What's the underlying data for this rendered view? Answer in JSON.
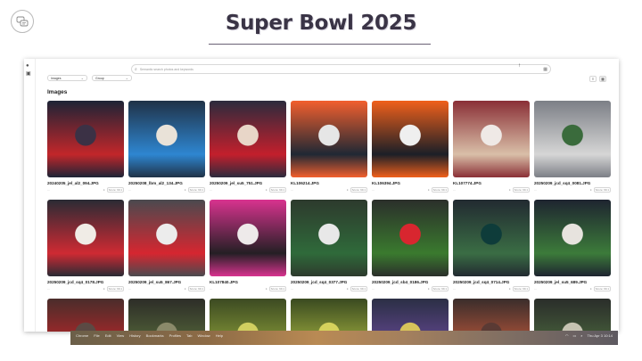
{
  "slide": {
    "title": "Super Bowl 2025"
  },
  "app": {
    "search_placeholder": "Semantic search photos and keywords",
    "filters": [
      "Images",
      "Group"
    ],
    "section_title": "Images",
    "photos": [
      {
        "name": "20240205_jel_al2_094.JPG",
        "meta": "...",
        "badge": "Score: 99.1",
        "colors": [
          "#1d2436",
          "#c2262a",
          "#3b3145"
        ]
      },
      {
        "name": "20250208_lbm_al2_134.JPG",
        "meta": "...",
        "badge": "Score: 99.1",
        "colors": [
          "#203247",
          "#2e86d1",
          "#e9e2d8"
        ]
      },
      {
        "name": "20250209_jel_su5_751.JPG",
        "meta": "...",
        "badge": "Score: 99.1",
        "colors": [
          "#2c2b3d",
          "#c31f2c",
          "#e8d6c8"
        ]
      },
      {
        "name": "KL106214.JPG",
        "meta": "...",
        "badge": "Score: 99.1",
        "colors": [
          "#f25f2e",
          "#1f2834",
          "#e6e6e6"
        ]
      },
      {
        "name": "KL106394.JPG",
        "meta": "...",
        "badge": "Score: 99.1",
        "colors": [
          "#f0601b",
          "#1b1f27",
          "#efefef"
        ]
      },
      {
        "name": "KL107774.JPG",
        "meta": "...",
        "badge": "Score: 99.1",
        "colors": [
          "#8a2f36",
          "#d9bfa8",
          "#efe9e6"
        ]
      },
      {
        "name": "20250209_jcd_sq4_0081.JPG",
        "meta": "...",
        "badge": "Score: 99.1",
        "colors": [
          "#7c7f86",
          "#d6d6d6",
          "#3a6b3c"
        ]
      },
      {
        "name": "20250209_jcd_sq4_0178.JPG",
        "meta": "...",
        "badge": "Score: 99.1",
        "colors": [
          "#2a2b34",
          "#cf2a33",
          "#f0ece6"
        ]
      },
      {
        "name": "20250209_jel_su5_867.JPG",
        "meta": "...",
        "badge": "Score: 99.1",
        "colors": [
          "#4a4a4f",
          "#d62630",
          "#ececec"
        ]
      },
      {
        "name": "KL107840.JPG",
        "meta": "...",
        "badge": "Score: 99.1",
        "colors": [
          "#d8338f",
          "#241f24",
          "#eeeaea"
        ]
      },
      {
        "name": "20250209_jcd_sq4_0377.JPG",
        "meta": "...",
        "badge": "Score: 99.1",
        "colors": [
          "#2d3a2d",
          "#2f6a3a",
          "#e8e8e8"
        ]
      },
      {
        "name": "20250209_jcd_sb4_0186.JPG",
        "meta": "...",
        "badge": "Score: 99.1",
        "colors": [
          "#2b2f2b",
          "#3a7a2e",
          "#d8262f"
        ]
      },
      {
        "name": "20250209_jcd_sq4_0714.JPG",
        "meta": "...",
        "badge": "Score: 99.1",
        "colors": [
          "#222a31",
          "#3a6d44",
          "#0e3c3a"
        ]
      },
      {
        "name": "20250209_jel_su5_689.JPG",
        "meta": "...",
        "badge": "Score: 99.1",
        "colors": [
          "#1e2430",
          "#3c7b3a",
          "#e7e3de"
        ]
      },
      {
        "name": "",
        "meta": "",
        "badge": "",
        "colors": [
          "#4a2d2b",
          "#c02629",
          "#5b4a44"
        ]
      },
      {
        "name": "",
        "meta": "",
        "badge": "",
        "colors": [
          "#2d2d28",
          "#5a6f3c",
          "#8a8a6a"
        ]
      },
      {
        "name": "",
        "meta": "",
        "badge": "",
        "colors": [
          "#3c4a22",
          "#8fa23a",
          "#d0cf60"
        ]
      },
      {
        "name": "",
        "meta": "",
        "badge": "",
        "colors": [
          "#3a4a20",
          "#a7b541",
          "#d5d25c"
        ]
      },
      {
        "name": "",
        "meta": "",
        "badge": "",
        "colors": [
          "#2b2f45",
          "#6a4a9a",
          "#d8c35a"
        ]
      },
      {
        "name": "",
        "meta": "",
        "badge": "",
        "colors": [
          "#3a2d2b",
          "#c45a3c",
          "#5a3a34"
        ]
      },
      {
        "name": "",
        "meta": "",
        "badge": "",
        "colors": [
          "#2a2d2a",
          "#4d6b3f",
          "#c6c3b2"
        ]
      }
    ]
  },
  "taskbar": {
    "menu": [
      "Chrome",
      "File",
      "Edit",
      "View",
      "History",
      "Bookmarks",
      "Profiles",
      "Tab",
      "Window",
      "Help"
    ],
    "clock": "Thu Apr 3  10:14"
  }
}
